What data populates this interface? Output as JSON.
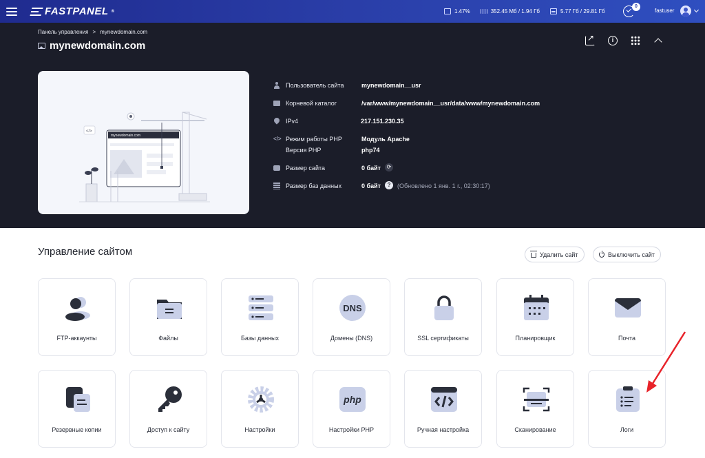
{
  "topbar": {
    "logo_text": "FASTPANEL",
    "logo_reg": "®",
    "cpu": "1.47%",
    "ram": "352.45 Мб / 1.94 Гб",
    "disk": "5.77 Гб / 29.81 Гб",
    "notifications_count": "0",
    "username": "fastuser"
  },
  "header": {
    "breadcrumb_root": "Панель управления",
    "breadcrumb_sep": ">",
    "breadcrumb_current": "mynewdomain.com",
    "title": "mynewdomain.com"
  },
  "preview": {
    "url_text": "mynewdomain.com"
  },
  "info": {
    "user_label": "Пользователь сайта",
    "user_value": "mynewdomain__usr",
    "root_label": "Корневой каталог",
    "root_value": "/var/www/mynewdomain__usr/data/www/mynewdomain.com",
    "ip_label": "IPv4",
    "ip_value": "217.151.230.35",
    "php_mode_label": "Режим работы PHP",
    "php_mode_value": "Модуль Apache",
    "php_version_label": "Версия PHP",
    "php_version_value": "php74",
    "site_size_label": "Размер сайта",
    "site_size_value": "0 байт",
    "db_size_label": "Размер баз данных",
    "db_size_value": "0 байт",
    "db_size_note": "(Обновлено 1 янв. 1 г., 02:30:17)",
    "help_mark": "?"
  },
  "section": {
    "title": "Управление сайтом",
    "delete_label": "Удалить сайт",
    "disable_label": "Выключить сайт"
  },
  "tiles": [
    {
      "label": "FTP-аккаунты",
      "icon": "users-icon"
    },
    {
      "label": "Файлы",
      "icon": "folder-icon"
    },
    {
      "label": "Базы данных",
      "icon": "database-icon"
    },
    {
      "label": "Домены (DNS)",
      "icon": "dns-icon",
      "icon_text": "DNS"
    },
    {
      "label": "SSL сертификаты",
      "icon": "lock-icon"
    },
    {
      "label": "Планировщик",
      "icon": "calendar-icon"
    },
    {
      "label": "Почта",
      "icon": "mail-icon"
    },
    {
      "label": "Резервные копии",
      "icon": "backup-icon"
    },
    {
      "label": "Доступ к сайту",
      "icon": "key-icon"
    },
    {
      "label": "Настройки",
      "icon": "gear-icon"
    },
    {
      "label": "Настройки PHP",
      "icon": "php-icon",
      "icon_text": "php"
    },
    {
      "label": "Ручная настройка",
      "icon": "code-icon"
    },
    {
      "label": "Сканирование",
      "icon": "scan-icon"
    },
    {
      "label": "Логи",
      "icon": "logs-icon"
    }
  ],
  "colors": {
    "accent": "#2a3ea8",
    "dark_bg": "#1b1d29",
    "icon_light": "#c9d0e8",
    "icon_dark": "#2b2f3a",
    "arrow": "#e8232a"
  }
}
